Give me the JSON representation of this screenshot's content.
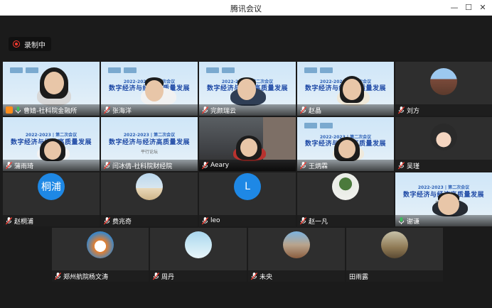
{
  "window": {
    "title": "腾讯会议"
  },
  "recording": {
    "label": "录制中"
  },
  "banner": {
    "subtitle": "2022-2023 | 第二次会议",
    "headline": "数字经济与经济高质量发展",
    "script": "平行论坛"
  },
  "participants": [
    {
      "name": "曹婧-社科院金融所",
      "mic": "on"
    },
    {
      "name": "张海洋",
      "mic": "off"
    },
    {
      "name": "完颜瑞云",
      "mic": "off"
    },
    {
      "name": "赵晶",
      "mic": "off"
    },
    {
      "name": "刘方",
      "mic": "off"
    },
    {
      "name": "蒲雨琦",
      "mic": "off"
    },
    {
      "name": "闫冰倩-社科院财经院",
      "mic": "off"
    },
    {
      "name": "Aeary",
      "mic": "off"
    },
    {
      "name": "王炳霖",
      "mic": "off"
    },
    {
      "name": "吴瑾",
      "mic": "off"
    },
    {
      "name": "赵桐浦",
      "mic": "off",
      "avatar_text": "桐浦"
    },
    {
      "name": "费兆奇",
      "mic": "off"
    },
    {
      "name": "leo",
      "mic": "off",
      "avatar_text": "L"
    },
    {
      "name": "赵一凡",
      "mic": "off"
    },
    {
      "name": "谢谦",
      "mic": "on"
    },
    {
      "name": "郑州航院杨文涛",
      "mic": "off"
    },
    {
      "name": "周丹",
      "mic": "off"
    },
    {
      "name": "未央",
      "mic": "off"
    },
    {
      "name": "田雨露",
      "mic": "none"
    }
  ],
  "colors": {
    "accent": "#1e88e5",
    "speaking": "#3cc05c",
    "muted": "#ff3b30"
  }
}
